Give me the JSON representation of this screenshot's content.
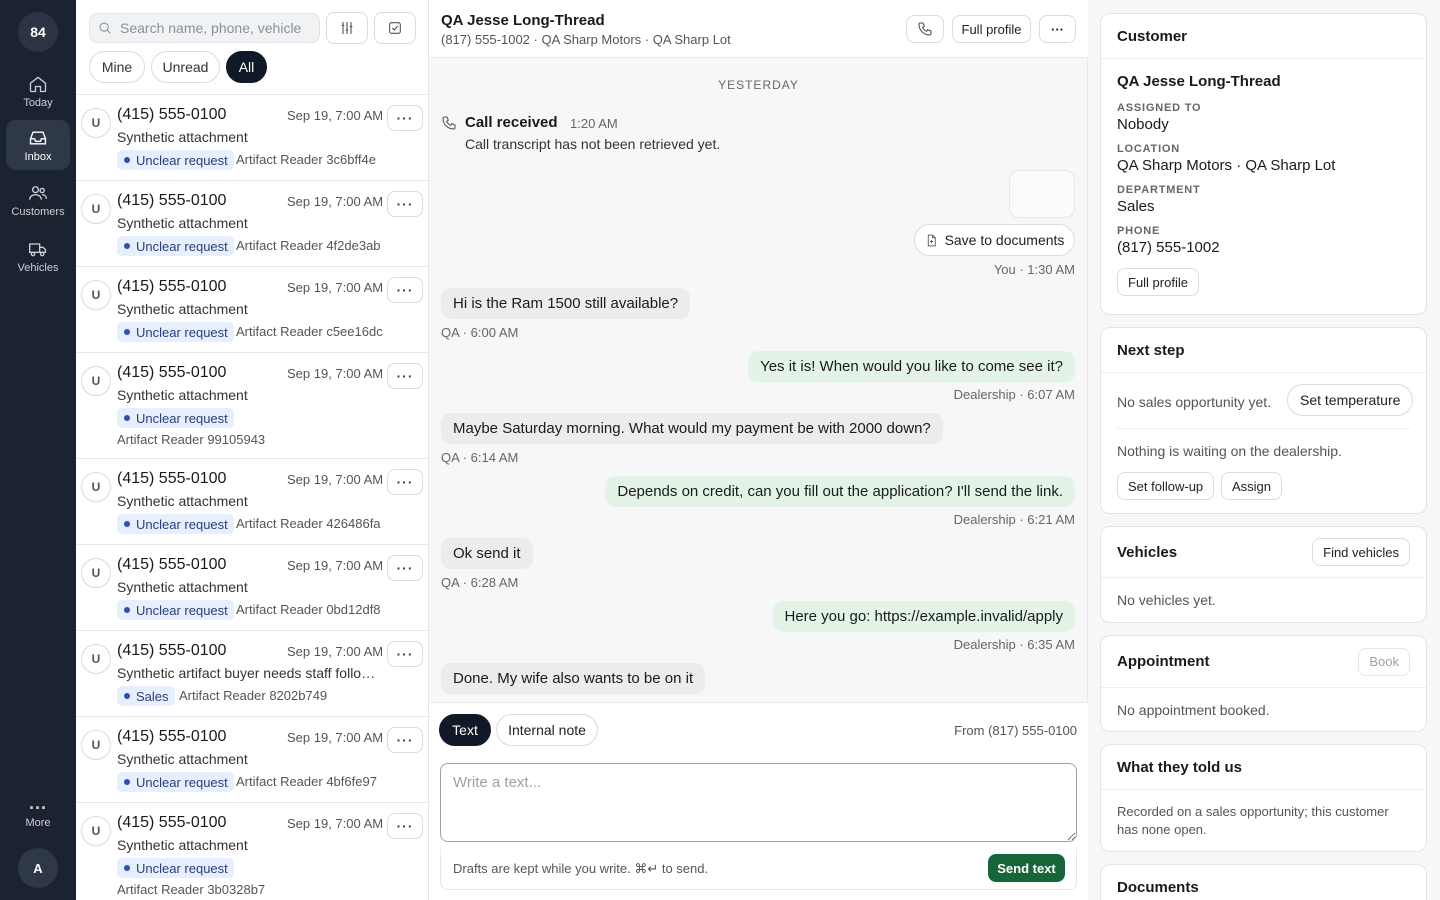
{
  "rail": {
    "badge": "84",
    "items": [
      {
        "label": "Today",
        "icon": "home-icon"
      },
      {
        "label": "Inbox",
        "icon": "inbox-icon"
      },
      {
        "label": "Customers",
        "icon": "users-icon"
      },
      {
        "label": "Vehicles",
        "icon": "truck-icon"
      }
    ],
    "more_label": "More",
    "avatar": "A"
  },
  "list": {
    "search_placeholder": "Search name, phone, vehicle",
    "filters": [
      "Mine",
      "Unread",
      "All"
    ],
    "active_filter": "All",
    "conversations": [
      {
        "avatar": "U",
        "phone": "(415) 555-0100",
        "date": "Sep 19, 7:00 AM",
        "snippet": "Synthetic attachment",
        "tag": "Unclear request",
        "reader": "Artifact Reader 3c6bff4e"
      },
      {
        "avatar": "U",
        "phone": "(415) 555-0100",
        "date": "Sep 19, 7:00 AM",
        "snippet": "Synthetic attachment",
        "tag": "Unclear request",
        "reader": "Artifact Reader 4f2de3ab"
      },
      {
        "avatar": "U",
        "phone": "(415) 555-0100",
        "date": "Sep 19, 7:00 AM",
        "snippet": "Synthetic attachment",
        "tag": "Unclear request",
        "reader": "Artifact Reader c5ee16dc"
      },
      {
        "avatar": "U",
        "phone": "(415) 555-0100",
        "date": "Sep 19, 7:00 AM",
        "snippet": "Synthetic attachment",
        "tag": "Unclear request",
        "reader": "Artifact Reader 99105943"
      },
      {
        "avatar": "U",
        "phone": "(415) 555-0100",
        "date": "Sep 19, 7:00 AM",
        "snippet": "Synthetic attachment",
        "tag": "Unclear request",
        "reader": "Artifact Reader 426486fa"
      },
      {
        "avatar": "U",
        "phone": "(415) 555-0100",
        "date": "Sep 19, 7:00 AM",
        "snippet": "Synthetic attachment",
        "tag": "Unclear request",
        "reader": "Artifact Reader 0bd12df8"
      },
      {
        "avatar": "U",
        "phone": "(415) 555-0100",
        "date": "Sep 19, 7:00 AM",
        "snippet": "Synthetic artifact buyer needs staff follow-...",
        "tag": "Sales",
        "reader": "Artifact Reader 8202b749"
      },
      {
        "avatar": "U",
        "phone": "(415) 555-0100",
        "date": "Sep 19, 7:00 AM",
        "snippet": "Synthetic attachment",
        "tag": "Unclear request",
        "reader": "Artifact Reader 4bf6fe97"
      },
      {
        "avatar": "U",
        "phone": "(415) 555-0100",
        "date": "Sep 19, 7:00 AM",
        "snippet": "Synthetic attachment",
        "tag": "Unclear request",
        "reader": "Artifact Reader 3b0328b7"
      }
    ],
    "more_glyph": "···"
  },
  "chat": {
    "title": "QA Jesse Long-Thread",
    "subtitle": "(817) 555-1002 · QA Sharp Motors · QA Sharp Lot",
    "full_profile": "Full profile",
    "more_glyph": "···",
    "day_divider": "YESTERDAY",
    "call": {
      "title": "Call received",
      "time": "1:20 AM",
      "body": "Call transcript has not been retrieved yet."
    },
    "save_to_documents": "Save to documents",
    "attachment_meta": "You · 1:30 AM",
    "messages": [
      {
        "dir": "in",
        "text": "Hi is the Ram 1500 still available?",
        "meta": "QA · 6:00 AM"
      },
      {
        "dir": "out",
        "text": "Yes it is! When would you like to come see it?",
        "meta": "Dealership · 6:07 AM"
      },
      {
        "dir": "in",
        "text": "Maybe Saturday morning. What would my payment be with 2000 down?",
        "meta": "QA · 6:14 AM"
      },
      {
        "dir": "out",
        "text": "Depends on credit, can you fill out the application? I'll send the link.",
        "meta": "Dealership · 6:21 AM"
      },
      {
        "dir": "in",
        "text": "Ok send it",
        "meta": "QA · 6:28 AM"
      },
      {
        "dir": "out",
        "text": "Here you go: https://example.invalid/apply",
        "meta": "Dealership · 6:35 AM"
      },
      {
        "dir": "in",
        "text": "Done. My wife also wants to be on it",
        "meta": ""
      }
    ],
    "composer": {
      "tabs": [
        "Text",
        "Internal note"
      ],
      "active_tab": "Text",
      "from": "From (817) 555-0100",
      "placeholder": "Write a text...",
      "hint": "Drafts are kept while you write. ⌘↵ to send.",
      "send": "Send text"
    }
  },
  "side": {
    "customer": {
      "heading": "Customer",
      "name": "QA Jesse Long-Thread",
      "assigned_label": "ASSIGNED TO",
      "assigned": "Nobody",
      "location_label": "LOCATION",
      "location": "QA Sharp Motors · QA Sharp Lot",
      "department_label": "DEPARTMENT",
      "department": "Sales",
      "phone_label": "PHONE",
      "phone": "(817) 555-1002",
      "full_profile": "Full profile"
    },
    "next_step": {
      "heading": "Next step",
      "no_opp": "No sales opportunity yet.",
      "set_temperature": "Set temperature",
      "waiting": "Nothing is waiting on the dealership.",
      "set_followup": "Set follow-up",
      "assign": "Assign"
    },
    "vehicles": {
      "heading": "Vehicles",
      "find": "Find vehicles",
      "empty": "No vehicles yet."
    },
    "appointment": {
      "heading": "Appointment",
      "book": "Book",
      "empty": "No appointment booked."
    },
    "told_us": {
      "heading": "What they told us",
      "body": "Recorded on a sales opportunity; this customer has none open."
    },
    "documents": {
      "heading": "Documents"
    }
  }
}
